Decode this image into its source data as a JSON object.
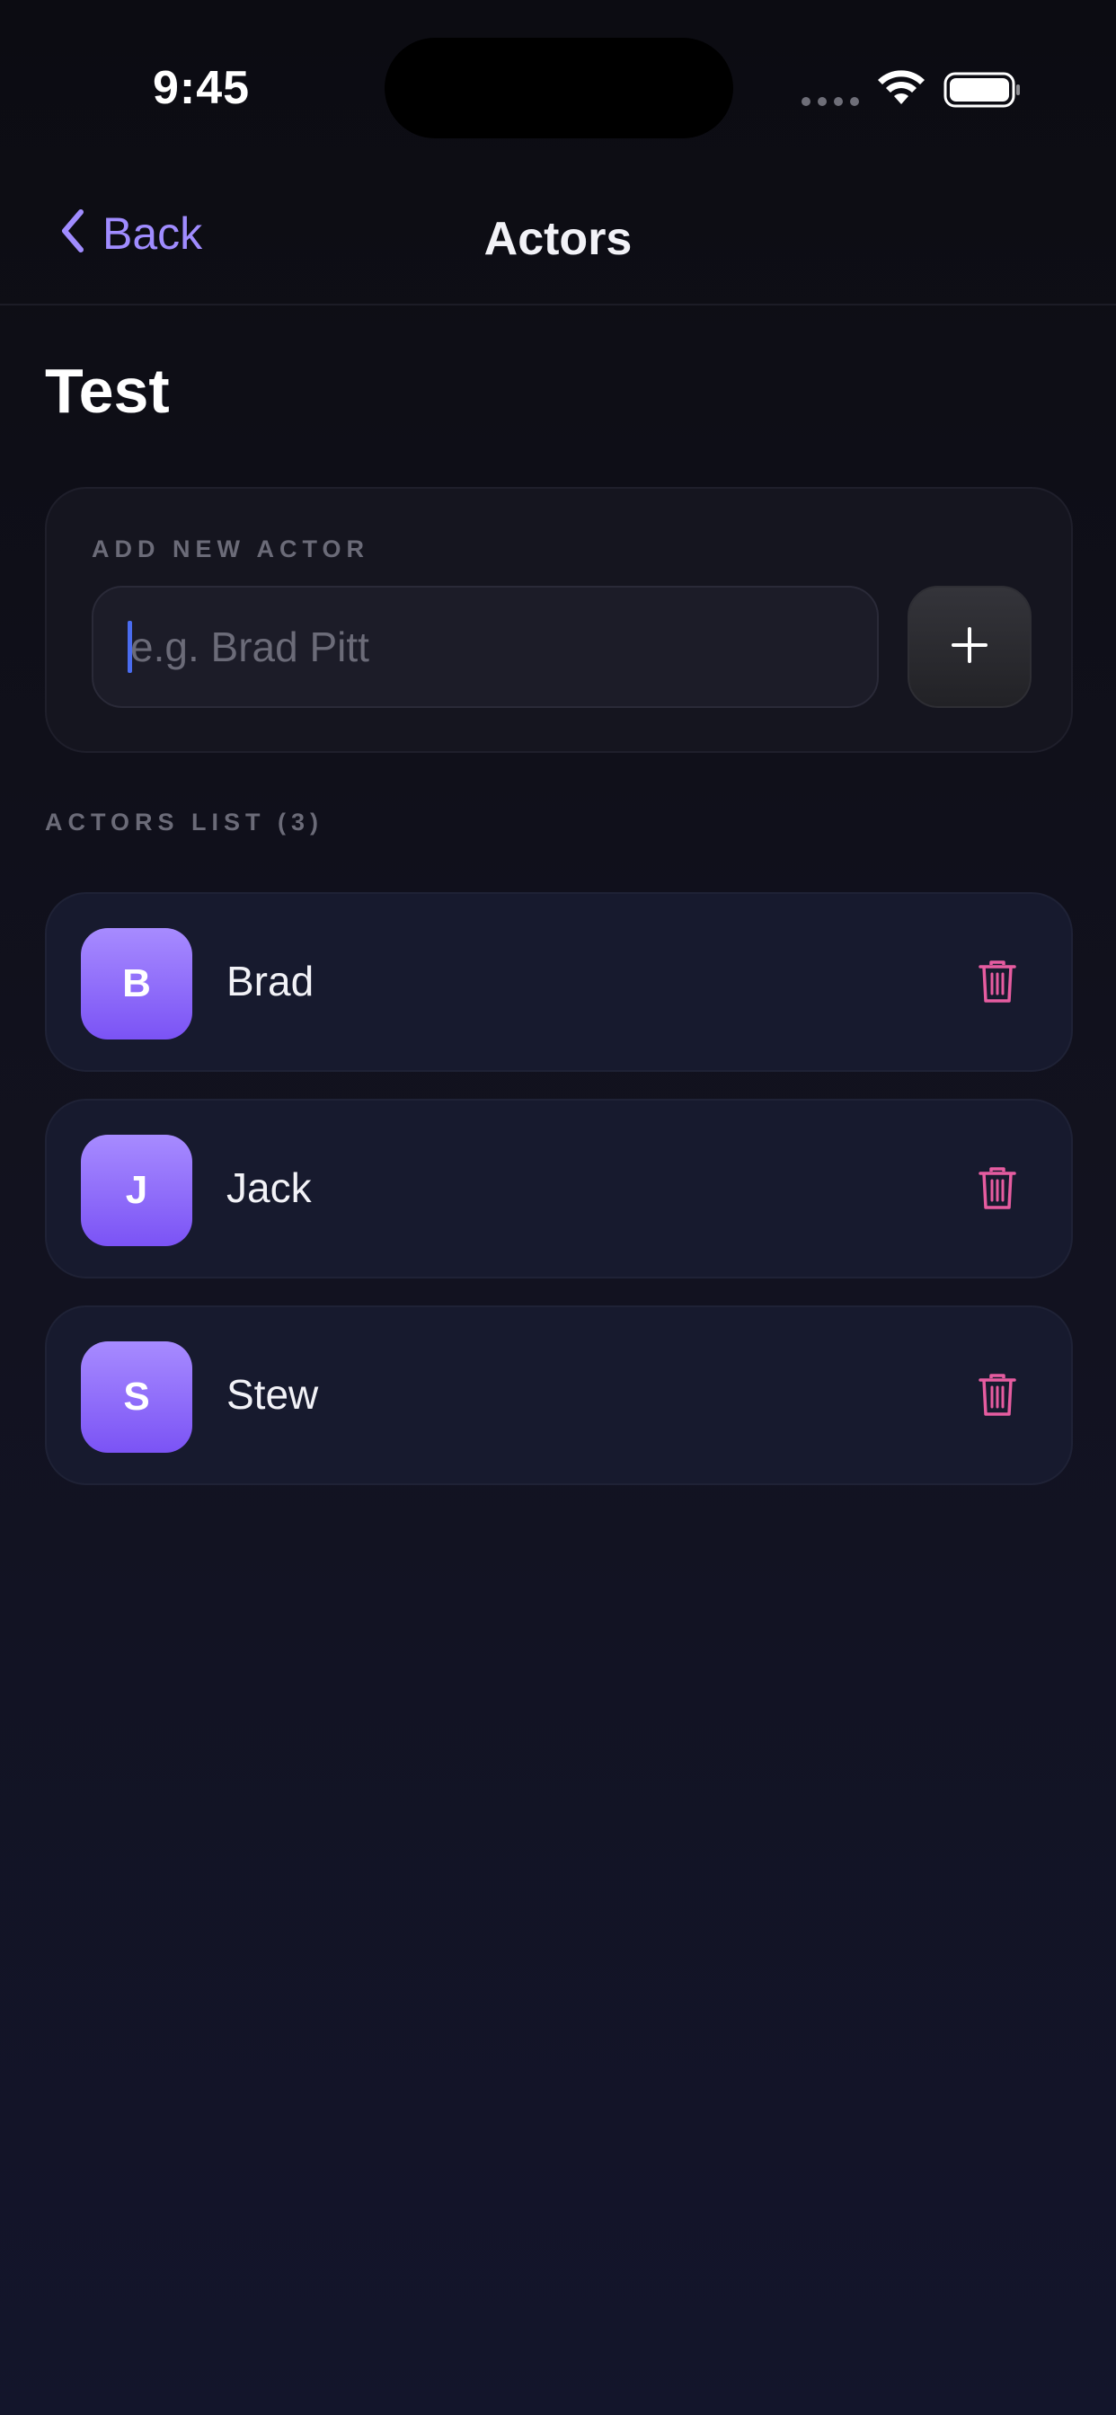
{
  "status_bar": {
    "time": "9:45"
  },
  "nav": {
    "back_label": "Back",
    "title": "Actors"
  },
  "page": {
    "title": "Test"
  },
  "add_card": {
    "section_label": "ADD NEW ACTOR",
    "input_value": "",
    "input_placeholder": "e.g. Brad Pitt",
    "add_button_icon": "plus-icon"
  },
  "list": {
    "section_label": "ACTORS LIST (3)",
    "actors": [
      {
        "initial": "B",
        "name": "Brad"
      },
      {
        "initial": "J",
        "name": "Jack"
      },
      {
        "initial": "S",
        "name": "Stew"
      }
    ],
    "delete_icon": "trash-icon"
  },
  "colors": {
    "accent": "#a08cff",
    "avatar_gradient_top": "#a78bff",
    "avatar_gradient_bottom": "#7b53f5",
    "delete_icon": "#e65ca0",
    "background": "#0c0c12"
  }
}
